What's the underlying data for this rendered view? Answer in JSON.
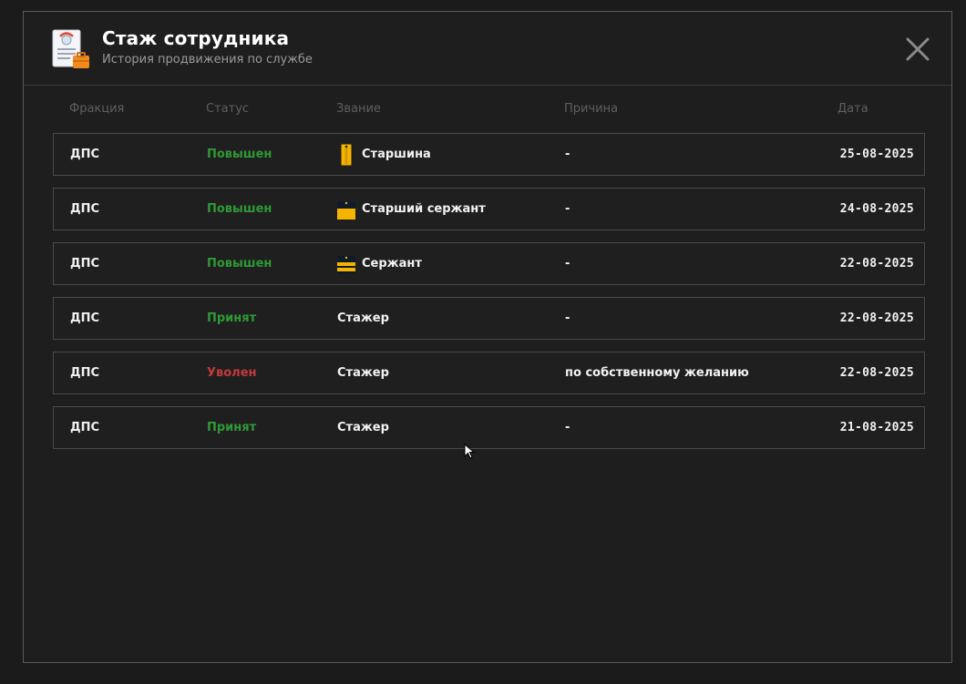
{
  "modal": {
    "title": "Стаж сотрудника",
    "subtitle": "История продвижения по службе"
  },
  "columns": {
    "faction": "Фракция",
    "status": "Статус",
    "rank": "Звание",
    "reason": "Причина",
    "date": "Дата"
  },
  "colors": {
    "promoted": "#2e9a35",
    "fired": "#c23a3a",
    "accent_gold": "#f4b400"
  },
  "rows": [
    {
      "faction": "ДПС",
      "status": "Повышен",
      "status_type": "promoted",
      "rank": "Старшина",
      "rank_icon": "starshina-insignia-icon",
      "reason": "-",
      "date": "25-08-2025"
    },
    {
      "faction": "ДПС",
      "status": "Повышен",
      "status_type": "promoted",
      "rank": "Старший сержант",
      "rank_icon": "senior-sergeant-insignia-icon",
      "reason": "-",
      "date": "24-08-2025"
    },
    {
      "faction": "ДПС",
      "status": "Повышен",
      "status_type": "promoted",
      "rank": "Сержант",
      "rank_icon": "sergeant-insignia-icon",
      "reason": "-",
      "date": "22-08-2025"
    },
    {
      "faction": "ДПС",
      "status": "Принят",
      "status_type": "promoted",
      "rank": "Стажер",
      "rank_icon": "",
      "reason": "-",
      "date": "22-08-2025"
    },
    {
      "faction": "ДПС",
      "status": "Уволен",
      "status_type": "fired",
      "rank": "Стажер",
      "rank_icon": "",
      "reason": "по собственному желанию",
      "date": "22-08-2025"
    },
    {
      "faction": "ДПС",
      "status": "Принят",
      "status_type": "promoted",
      "rank": "Стажер",
      "rank_icon": "",
      "reason": "-",
      "date": "21-08-2025"
    }
  ]
}
